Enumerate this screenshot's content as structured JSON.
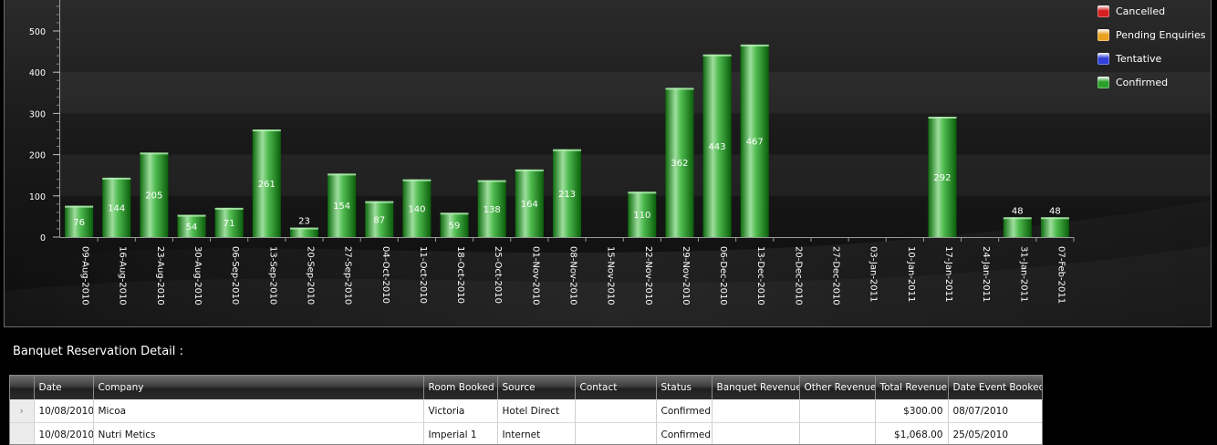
{
  "chart_data": {
    "type": "bar",
    "categories": [
      "09-Aug-2010",
      "16-Aug-2010",
      "23-Aug-2010",
      "30-Aug-2010",
      "06-Sep-2010",
      "13-Sep-2010",
      "20-Sep-2010",
      "27-Sep-2010",
      "04-Oct-2010",
      "11-Oct-2010",
      "18-Oct-2010",
      "25-Oct-2010",
      "01-Nov-2010",
      "08-Nov-2010",
      "15-Nov-2010",
      "22-Nov-2010",
      "29-Nov-2010",
      "06-Dec-2010",
      "13-Dec-2010",
      "20-Dec-2010",
      "27-Dec-2010",
      "03-Jan-2011",
      "10-Jan-2011",
      "17-Jan-2011",
      "24-Jan-2011",
      "31-Jan-2011",
      "07-Feb-2011"
    ],
    "series": [
      {
        "name": "Confirmed",
        "values": [
          76,
          144,
          205,
          54,
          71,
          261,
          23,
          154,
          87,
          140,
          59,
          138,
          164,
          213,
          0,
          110,
          362,
          443,
          467,
          0,
          0,
          0,
          0,
          292,
          0,
          48,
          48
        ]
      }
    ],
    "yticks": [
      0,
      100,
      200,
      300,
      400,
      500
    ],
    "ylim": [
      0,
      500
    ],
    "legend": [
      {
        "name": "Cancelled",
        "color": "#d42020"
      },
      {
        "name": "Pending Enquiries",
        "color": "#e8a020"
      },
      {
        "name": "Tentative",
        "color": "#3040d8"
      },
      {
        "name": "Confirmed",
        "color": "#2aa02a"
      }
    ],
    "legend_position": "top-right"
  },
  "section_title": "Banquet Reservation Detail :",
  "table": {
    "columns": [
      "Date",
      "Company",
      "Room Booked",
      "Source",
      "Contact",
      "Status",
      "Banquet Revenue",
      "Other Revenue",
      "Total Revenue",
      "Date Event Booked"
    ],
    "rows": [
      {
        "date": "10/08/2010",
        "company": "Micoa",
        "room": "Victoria",
        "source": "Hotel Direct",
        "contact": "",
        "status": "Confirmed",
        "banquet": "",
        "other": "",
        "total": "$300.00",
        "booked": "08/07/2010"
      },
      {
        "date": "10/08/2010",
        "company": "Nutri Metics",
        "room": "Imperial 1",
        "source": "Internet",
        "contact": "",
        "status": "Confirmed",
        "banquet": "",
        "other": "",
        "total": "$1,068.00",
        "booked": "25/05/2010"
      }
    ],
    "row_selector_glyph": "›"
  }
}
